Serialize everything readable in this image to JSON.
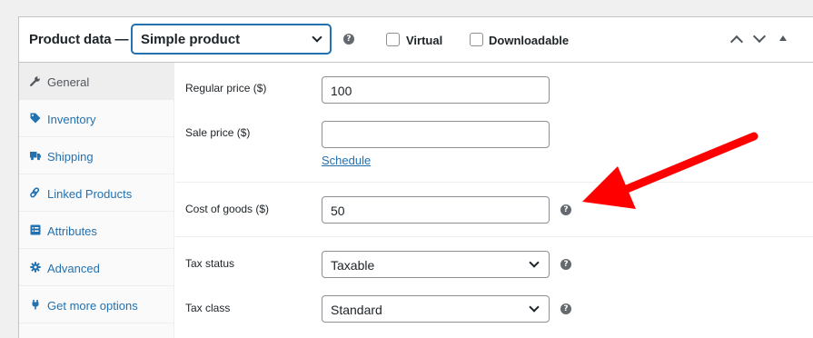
{
  "header": {
    "title": "Product data —",
    "product_type": "Simple product",
    "virtual_label": "Virtual",
    "downloadable_label": "Downloadable"
  },
  "sidebar": {
    "items": [
      {
        "label": "General",
        "icon": "wrench-icon",
        "active": true
      },
      {
        "label": "Inventory",
        "icon": "tag-icon"
      },
      {
        "label": "Shipping",
        "icon": "truck-icon"
      },
      {
        "label": "Linked Products",
        "icon": "link-icon"
      },
      {
        "label": "Attributes",
        "icon": "list-view-icon"
      },
      {
        "label": "Advanced",
        "icon": "gear-icon"
      },
      {
        "label": "Get more options",
        "icon": "plugin-icon"
      }
    ]
  },
  "general": {
    "regular_price_label": "Regular price ($)",
    "regular_price_value": "100",
    "sale_price_label": "Sale price ($)",
    "sale_price_value": "",
    "schedule_link": "Schedule",
    "cost_label": "Cost of goods ($)",
    "cost_value": "50",
    "tax_status_label": "Tax status",
    "tax_status_value": "Taxable",
    "tax_class_label": "Tax class",
    "tax_class_value": "Standard"
  },
  "help_glyph": "?",
  "colors": {
    "accent": "#2271b1",
    "annotation_arrow": "#ff0000",
    "text": "#1d2327",
    "border": "#c3c4c7"
  }
}
